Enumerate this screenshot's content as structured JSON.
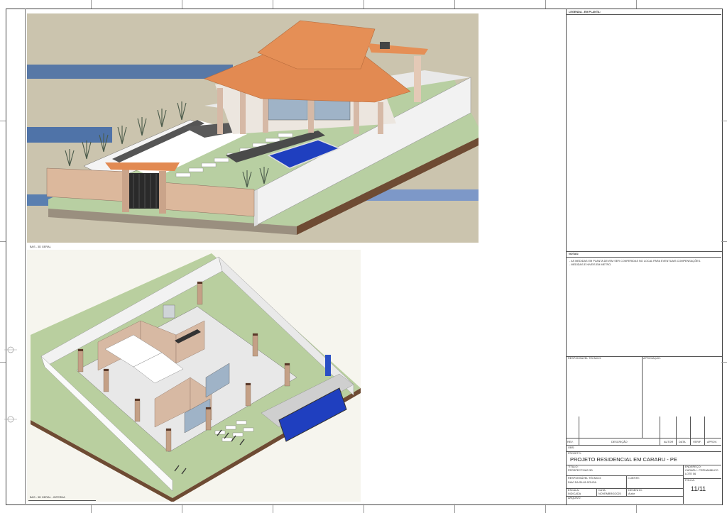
{
  "views": {
    "top": {
      "label": "BAS - 3D GERAL"
    },
    "bottom": {
      "label": "BAS - 3D GERAL - INTERNA"
    }
  },
  "legend": {
    "title": "LEGENDA - EM PLANTA:"
  },
  "notes": {
    "title": "NOTAS:",
    "line1": "- AS MEDIDAS EM PLANTA DEVEM SER CONFERIDAS NO LOCAL PARA EVENTUAIS COMPENSAÇÕES.",
    "line2": "- MEDIDAS E NIVEIS EM METRO."
  },
  "title_block": {
    "responsavel_tecnico_label": "RESPONSÁVEL TÉCNICO:",
    "aprovacao_label": "APROVAÇÃO:",
    "rev_table": {
      "rev": "REV.",
      "descricao": "DESCRIÇÃO",
      "autor": "AUTOR",
      "data": "DATA",
      "verif": "VERIF.",
      "aprov": "APROV."
    },
    "obs_label": "OBS:",
    "projeto_label": "PROJETO:",
    "projeto_value": "PROJETO RESIDENCIAL EM CARARU - PE",
    "titulo_label": "TÍTULO:",
    "titulo_value": "PERSPECTIVAS 3D",
    "endereco_label": "ENDEREÇO:",
    "endereco_line1": "CARARU - PERNAMBUCO",
    "endereco_line2": "LOTE 56",
    "responsavel_label": "RESPONSÁVEL TÉCNICO:",
    "responsavel_value": "DAVI DA SILVA SOUSA",
    "cliente_label": "CLIENTE:",
    "folha_label": "FOLHA:",
    "folha_value": "11/11",
    "escala_label": "ESCALA:",
    "escala_value": "INDICADA",
    "data_label": "DATA:",
    "data_value": "NOVEMBRO/2025",
    "desenho_label": "DESENHO:",
    "desenho_value": "Autor",
    "arquivo_label": "ARQUIVO:"
  },
  "colors": {
    "roof": "#e28a52",
    "pool": "#1f3fbf",
    "lawn": "#b7cc9e",
    "wall": "#d9b9a0",
    "sky": "#ccc5b0"
  }
}
